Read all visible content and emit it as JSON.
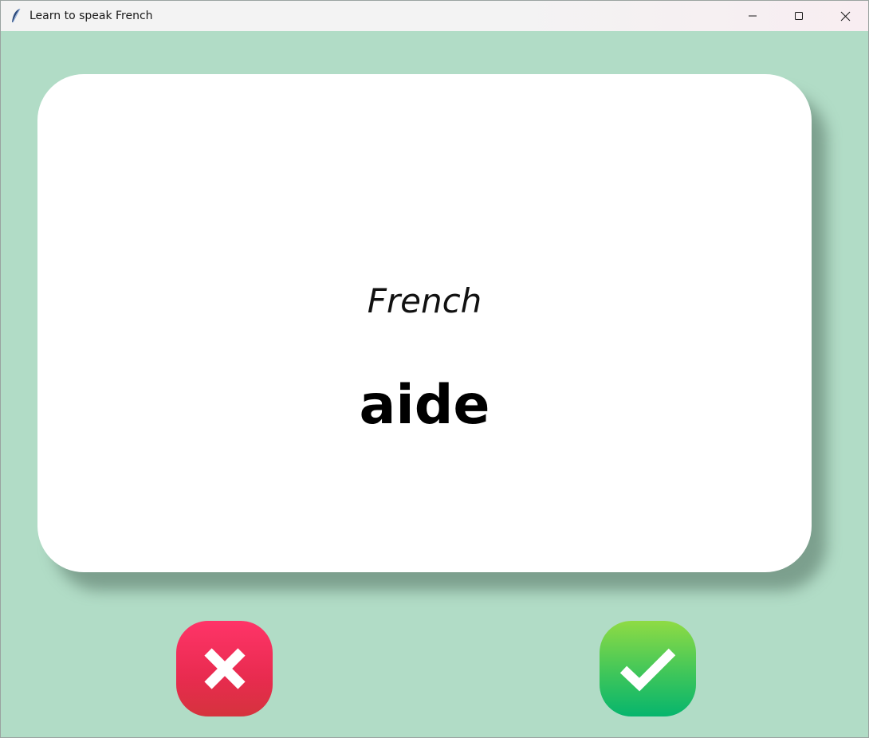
{
  "window": {
    "title": "Learn to speak French",
    "background_color": "#b1dcc6",
    "controls": [
      "minimize-icon",
      "maximize-icon",
      "close-icon"
    ]
  },
  "card": {
    "language": "French",
    "word": "aide",
    "background_color": "#ffffff"
  },
  "buttons": {
    "wrong": {
      "icon": "cross-icon",
      "color": "#ec2f57"
    },
    "right": {
      "icon": "checkmark-icon",
      "color": "#3fc65a"
    }
  }
}
